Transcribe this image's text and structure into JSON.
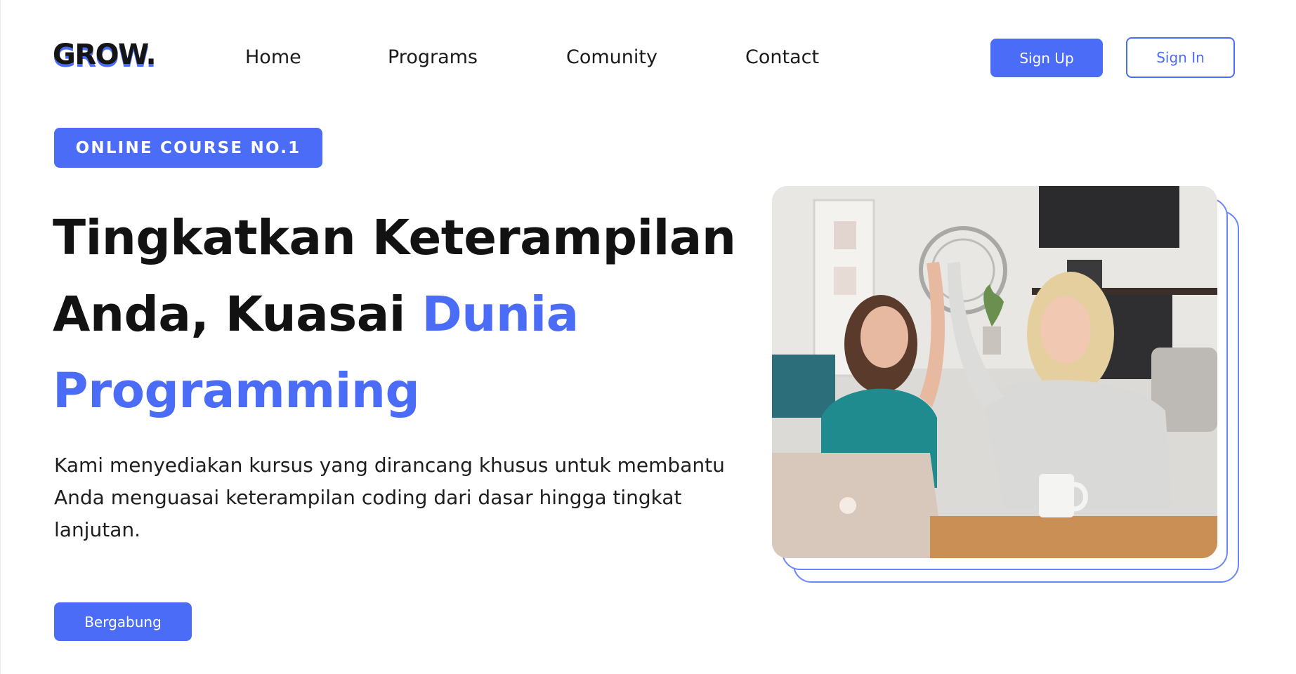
{
  "brand": {
    "logo": "GROW.",
    "accent_color": "#4a6cf7"
  },
  "nav": {
    "items": [
      {
        "label": "Home"
      },
      {
        "label": "Programs"
      },
      {
        "label": "Comunity"
      },
      {
        "label": "Contact"
      }
    ],
    "signup_label": "Sign Up",
    "signin_label": "Sign In"
  },
  "hero": {
    "badge": "ONLINE COURSE NO.1",
    "headline_part1": "Tingkatkan Keterampilan Anda, Kuasai ",
    "headline_accent": "Dunia Programming",
    "description": "Kami menyediakan kursus yang dirancang khusus untuk membantu Anda menguasai keterampilan coding dari dasar hingga tingkat lanjutan.",
    "cta_label": "Bergabung"
  }
}
